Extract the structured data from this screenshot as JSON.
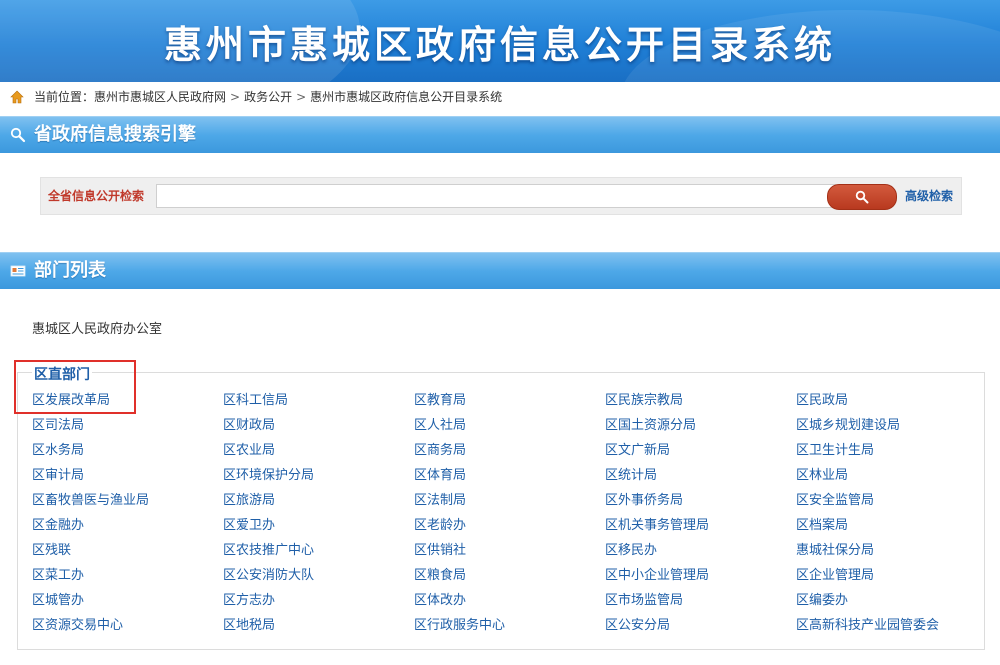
{
  "banner": {
    "title": "惠州市惠城区政府信息公开目录系统"
  },
  "breadcrumb": {
    "prefix": "当前位置：",
    "items": [
      "惠州市惠城区人民政府网",
      "政务公开",
      "惠州市惠城区政府信息公开目录系统"
    ]
  },
  "search_section": {
    "title": "省政府信息搜索引擎"
  },
  "search": {
    "label": "全省信息公开检索",
    "value": "",
    "advanced_label": "高级检索"
  },
  "dept_section": {
    "title": "部门列表"
  },
  "office": "惠城区人民政府办公室",
  "group": {
    "title": "区直部门",
    "departments": [
      "区发展改革局",
      "区科工信局",
      "区教育局",
      "区民族宗教局",
      "区民政局",
      "区司法局",
      "区财政局",
      "区人社局",
      "区国土资源分局",
      "区城乡规划建设局",
      "区水务局",
      "区农业局",
      "区商务局",
      "区文广新局",
      "区卫生计生局",
      "区审计局",
      "区环境保护分局",
      "区体育局",
      "区统计局",
      "区林业局",
      "区畜牧兽医与渔业局",
      "区旅游局",
      "区法制局",
      "区外事侨务局",
      "区安全监管局",
      "区金融办",
      "区爱卫办",
      "区老龄办",
      "区机关事务管理局",
      "区档案局",
      "区残联",
      "区农技推广中心",
      "区供销社",
      "区移民办",
      "惠城社保分局",
      "区菜工办",
      "区公安消防大队",
      "区粮食局",
      "区中小企业管理局",
      "区企业管理局",
      "区城管办",
      "区方志办",
      "区体改办",
      "区市场监管局",
      "区编委办",
      "区资源交易中心",
      "区地税局",
      "区行政服务中心",
      "区公安分局",
      "区高新科技产业园管委会"
    ]
  }
}
